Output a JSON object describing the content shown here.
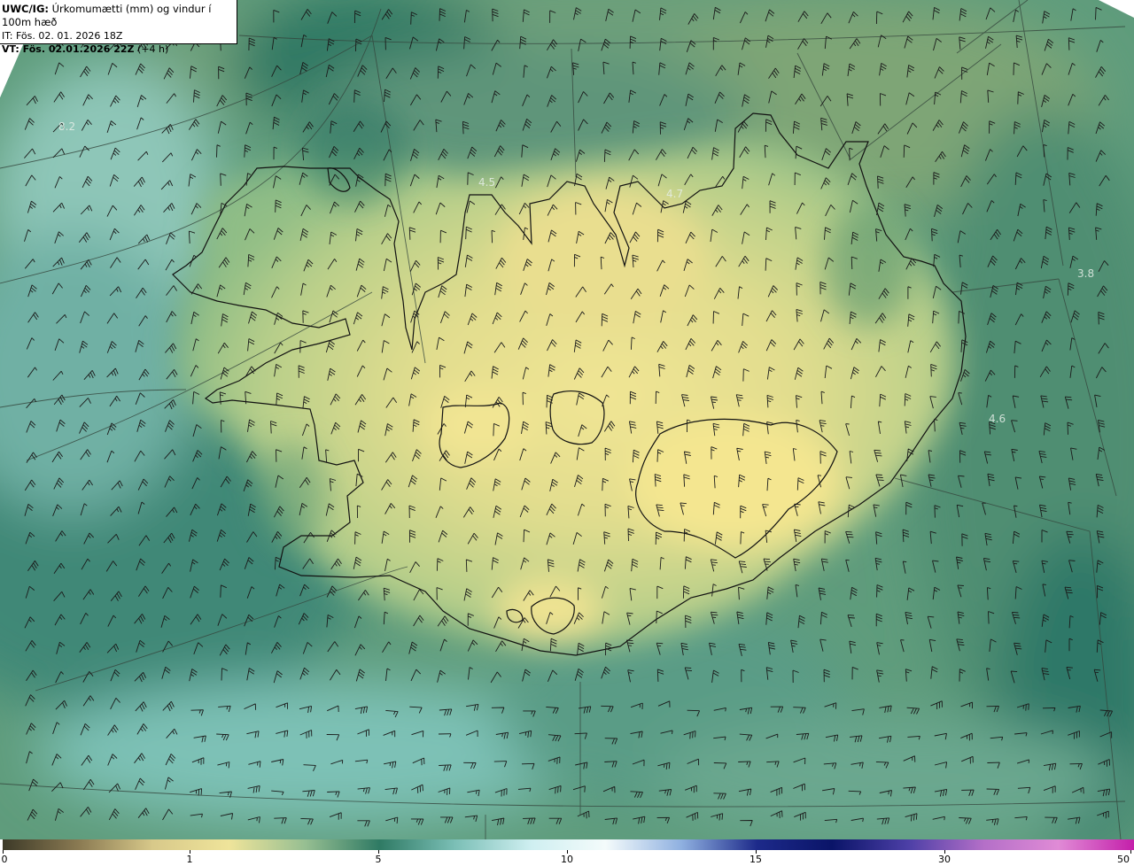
{
  "header": {
    "model": "UWC/IG:",
    "description": "Úrkomumætti (mm) og vindur í 100m hæð",
    "init_time": "IT: Fös. 02. 01. 2026 18Z",
    "valid_prefix": "VT: Fös. 02.01.2026 22Z",
    "valid_suffix": "(+4 h)"
  },
  "map_labels": [
    {
      "id": "nw",
      "text": "8.2"
    },
    {
      "id": "north-west",
      "text": "4.5"
    },
    {
      "id": "north-east",
      "text": "4.7"
    },
    {
      "id": "east-sea",
      "text": "3.8"
    },
    {
      "id": "east-coast",
      "text": "4.6"
    }
  ],
  "colorbar": {
    "ticks": [
      "0",
      "1",
      "5",
      "10",
      "15",
      "30",
      "50"
    ],
    "colors": [
      "#3d3a28",
      "#8a7a52",
      "#d8c98a",
      "#efe49a",
      "#97bf92",
      "#2f7a64",
      "#7bbfb6",
      "#cfeff1",
      "#f4fbfb",
      "#8fb0e0",
      "#1d2a8a",
      "#0a1468",
      "#4c3fa6",
      "#b46fc8",
      "#e08bd6",
      "#c41faa"
    ]
  }
}
